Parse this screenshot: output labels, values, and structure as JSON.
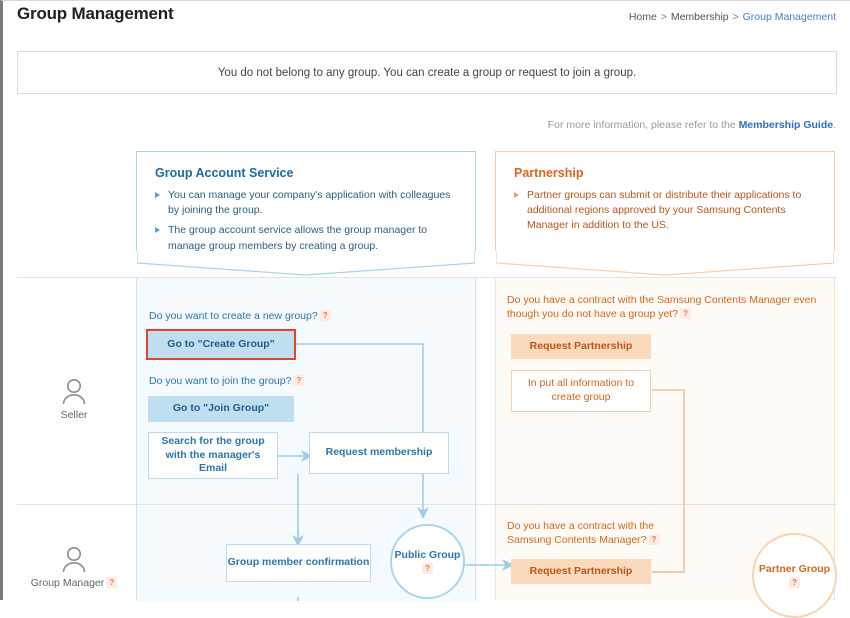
{
  "header": {
    "title": "Group Management",
    "breadcrumb": {
      "home": "Home",
      "section": "Membership",
      "current": "Group Management",
      "separator": ">"
    }
  },
  "notice": {
    "message": "You do not belong to any group. You can create a group or request to join a group."
  },
  "guide": {
    "prefix": "For more information, please refer to the ",
    "link": "Membership Guide",
    "suffix": "."
  },
  "panels": {
    "blue": {
      "title": "Group Account Service",
      "bullets": [
        "You can manage your company's application with colleagues by joining the group.",
        "The group account service allows the group manager to manage group members by creating a group."
      ]
    },
    "orange": {
      "title": "Partnership",
      "bullets": [
        "Partner groups can submit or distribute their applications to additional regions approved by your Samsung Contents Manager in addition to the US."
      ]
    }
  },
  "diagram": {
    "actors": {
      "seller": {
        "label": "Seller",
        "icon": "person-icon"
      },
      "group_manager": {
        "label": "Group Manager",
        "icon": "person-icon",
        "help": "?"
      }
    },
    "seller_row": {
      "blue": {
        "q_create": "Do you want to create a new group?",
        "q_create_help": "?",
        "btn_create": "Go to \"Create Group\"",
        "q_join": "Do you want to join the group?",
        "q_join_help": "?",
        "btn_join": "Go to \"Join Group\"",
        "node_search": "Search for the group with the manager's Email",
        "node_request": "Request membership"
      },
      "orange": {
        "q_contract": "Do you have a contract with the Samsung Contents Manager even though you do not have a group yet?",
        "q_contract_help": "?",
        "btn_partnership": "Request Partnership",
        "node_input": "In put all information to create group"
      }
    },
    "manager_row": {
      "blue": {
        "node_confirm": "Group member confirmation",
        "circle_public": "Public Group",
        "circle_public_help": "?"
      },
      "orange": {
        "q_contract": "Do you have a contract with the Samsung Contents Manager?",
        "q_contract_help": "?",
        "btn_partnership": "Request Partnership",
        "circle_partner": "Partner Group",
        "circle_partner_help": "?"
      }
    }
  },
  "colors": {
    "blue_accent": "#1b6ca8",
    "orange_accent": "#e0651f",
    "highlight_red": "#e8402a",
    "link_blue": "#2f6fc4",
    "blue_band": "#f4fafd",
    "orange_band": "#fefaf6"
  }
}
